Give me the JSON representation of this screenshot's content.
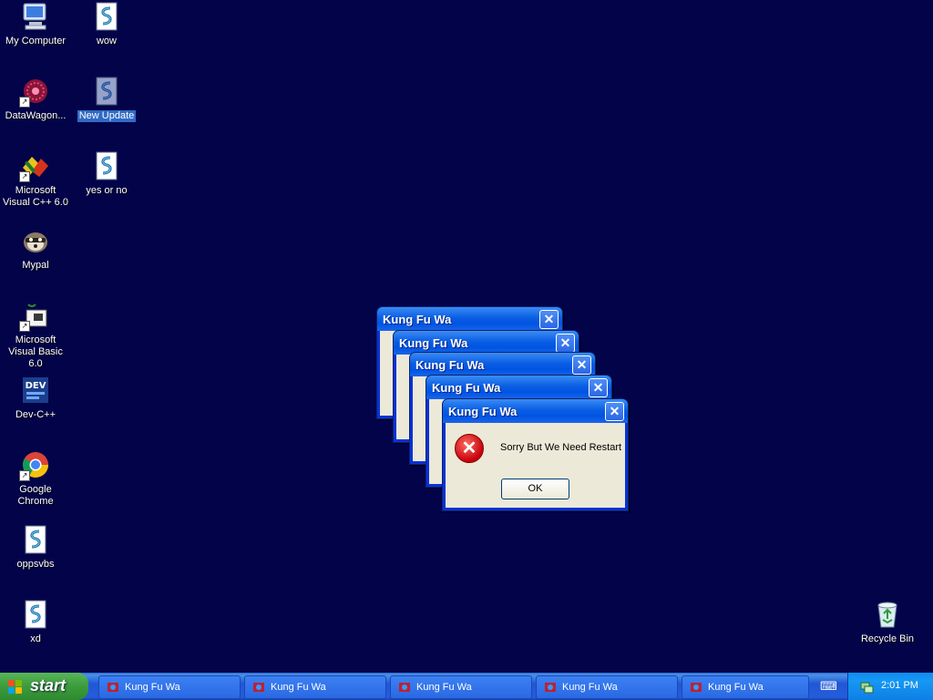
{
  "desktop": {
    "icons": [
      {
        "label": "My Computer"
      },
      {
        "label": "DataWagon..."
      },
      {
        "label": "Microsoft Visual C++ 6.0"
      },
      {
        "label": "Mypal"
      },
      {
        "label": "Microsoft Visual Basic 6.0"
      },
      {
        "label": "Dev-C++"
      },
      {
        "label": "Google Chrome"
      },
      {
        "label": "oppsvbs"
      },
      {
        "label": "xd"
      },
      {
        "label": "wow"
      },
      {
        "label": "New Update"
      },
      {
        "label": "yes or no"
      },
      {
        "label": "Recycle Bin"
      }
    ]
  },
  "dialogs": [
    {
      "title": "Kung Fu Wa",
      "close": "✕"
    },
    {
      "title": "Kung Fu Wa",
      "close": "✕"
    },
    {
      "title": "Kung Fu Wa",
      "close": "✕"
    },
    {
      "title": "Kung Fu Wa",
      "close": "✕"
    },
    {
      "title": "Kung Fu Wa",
      "close": "✕",
      "message": "Sorry But We Need Restart",
      "ok_label": "OK",
      "error_glyph": "✕"
    }
  ],
  "taskbar": {
    "start_label": "start",
    "tasks": [
      {
        "label": "Kung Fu Wa"
      },
      {
        "label": "Kung Fu Wa"
      },
      {
        "label": "Kung Fu Wa"
      },
      {
        "label": "Kung Fu Wa"
      },
      {
        "label": "Kung Fu Wa"
      }
    ],
    "keyboard_glyph": "⌨",
    "clock": "2:01 PM"
  },
  "colors": {
    "desktop_bg": "#03034a",
    "titlebar": "#0054e3",
    "start_green": "#3c9b3c",
    "selection": "#316ac5"
  }
}
